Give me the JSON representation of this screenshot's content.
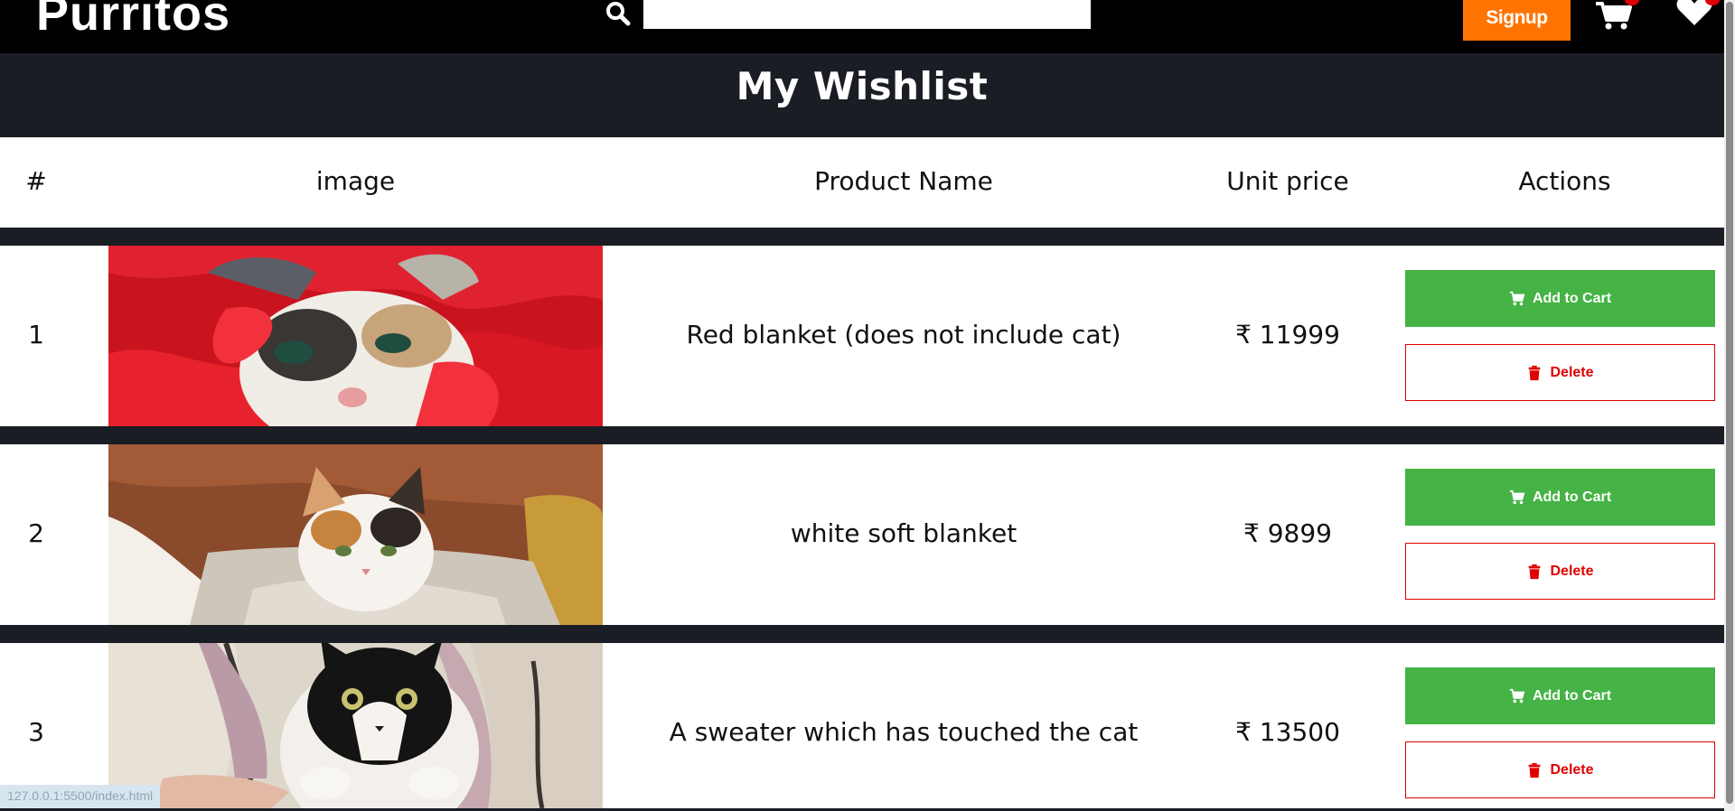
{
  "navbar": {
    "brand": "Purritos",
    "search_placeholder": "",
    "search_icon": "search-icon",
    "signup_label": "Signup",
    "cart_icon": "cart-icon",
    "wishlist_icon": "heart-icon"
  },
  "page": {
    "title": "My Wishlist"
  },
  "table": {
    "headers": [
      "#",
      "image",
      "Product Name",
      "Unit price",
      "Actions"
    ],
    "rows": [
      {
        "num": "1",
        "name": "Red blanket (does not include cat)",
        "price": "₹ 11999",
        "image": "cat in red knit blanket"
      },
      {
        "num": "2",
        "name": "white soft blanket",
        "price": "₹ 9899",
        "image": "calico cat in white blanket"
      },
      {
        "num": "3",
        "name": "A sweater which has touched the cat",
        "price": "₹ 13500",
        "image": "black and white cat in sweater"
      }
    ],
    "add_to_cart_label": "Add to Cart",
    "delete_label": "Delete"
  },
  "status_bar": {
    "url": "127.0.0.1:5500/index.html"
  },
  "colors": {
    "navbar": "#000000",
    "band": "#1a1d23",
    "signup": "#ff7400",
    "add_to_cart": "#45b346",
    "delete": "#e00000"
  }
}
